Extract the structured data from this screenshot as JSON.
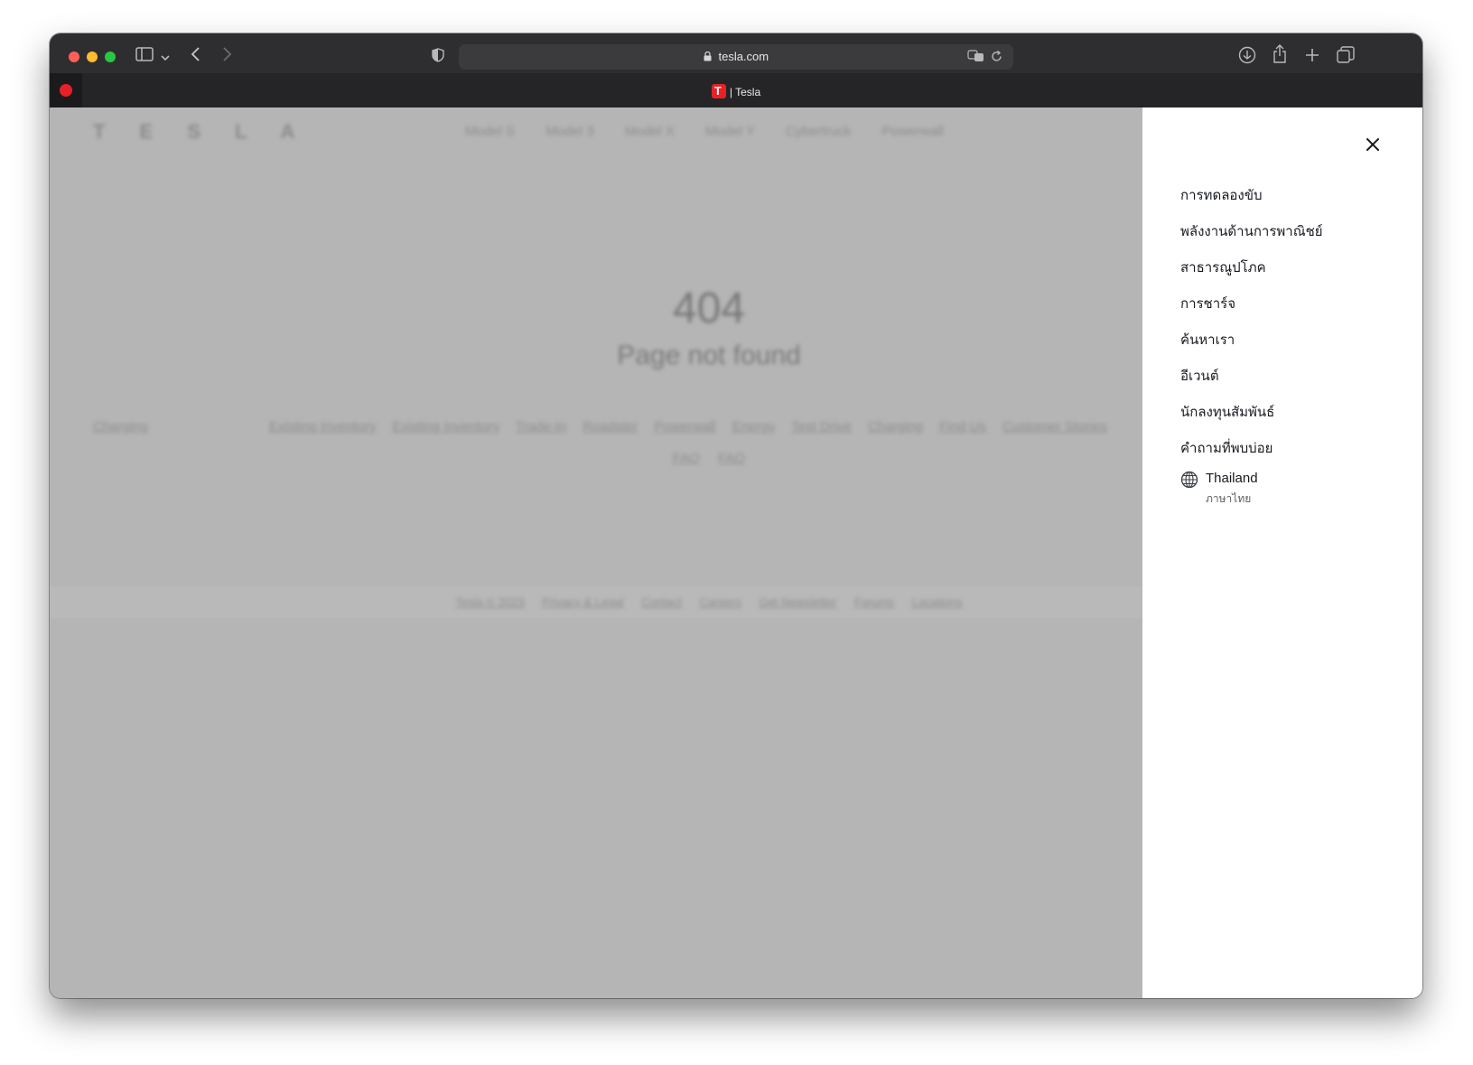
{
  "browser": {
    "url": "tesla.com",
    "tab_title": "| Tesla",
    "icons": [
      "sidebar-icon",
      "chevron-down-icon",
      "back-icon",
      "forward-icon",
      "shield-icon",
      "lock-icon",
      "translate-icon",
      "reload-icon",
      "download-icon",
      "share-icon",
      "plus-icon",
      "tabs-overview-icon"
    ]
  },
  "page": {
    "logo": "T E S L A",
    "nav": [
      "Model S",
      "Model 3",
      "Model X",
      "Model Y",
      "Cybertruck",
      "Powerwall"
    ],
    "error_code": "404",
    "error_message": "Page not found",
    "links_row1_left": "Charging",
    "links_row1": [
      "Existing Inventory",
      "Existing Inventory",
      "Trade-In",
      "Roadster",
      "Powerwall",
      "Energy",
      "Test Drive",
      "Charging",
      "Find Us",
      "Customer Stories"
    ],
    "links_row2": [
      "FAQ",
      "FAQ"
    ],
    "footer": [
      "Tesla © 2023",
      "Privacy & Legal",
      "Contact",
      "Careers",
      "Get Newsletter",
      "Forums",
      "Locations"
    ]
  },
  "drawer": {
    "menu": [
      "การทดลองขับ",
      "พลังงานด้านการพาณิชย์",
      "สาธารณูปโภค",
      "การชาร์จ",
      "ค้นหาเรา",
      "อีเวนต์",
      "นักลงทุนสัมพันธ์",
      "คำถามที่พบบ่อย"
    ],
    "region": "Thailand",
    "language": "ภาษาไทย"
  },
  "colors": {
    "tesla_red": "#e82127",
    "drawer_bg": "#ffffff",
    "overlay": "#b5b5b5",
    "text": "#171a20"
  }
}
